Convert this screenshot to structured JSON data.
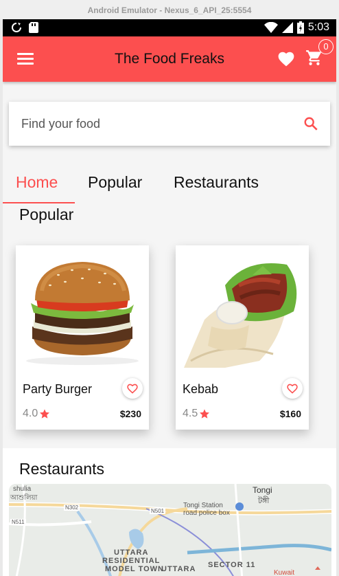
{
  "emulator": {
    "title": "Android Emulator - Nexus_6_API_25:5554"
  },
  "status_bar": {
    "time": "5:03"
  },
  "app_bar": {
    "title": "The Food Freaks",
    "cart_count": "0"
  },
  "search": {
    "placeholder": "Find your food"
  },
  "tabs": [
    {
      "label": "Home",
      "active": true
    },
    {
      "label": "Popular",
      "active": false
    },
    {
      "label": "Restaurants",
      "active": false
    }
  ],
  "popular": {
    "title": "Popular",
    "items": [
      {
        "name": "Party Burger",
        "rating": "4.0",
        "price": "$230"
      },
      {
        "name": "Kebab",
        "rating": "4.5",
        "price": "$160"
      }
    ]
  },
  "restaurants": {
    "title": "Restaurants",
    "map_labels": {
      "ashulia": "shulia",
      "ashulia_bn": "আশুলিয়া",
      "tongi": "Tongi",
      "tongi_bn": "টঙ্গী",
      "station": "Tongi Station",
      "police_box": "road police box",
      "uttara1": "UTTARA",
      "uttara2": "RESIDENTIAL",
      "uttara3": "MODEL TOWN",
      "uttara4": "UTTARA",
      "sector": "SECTOR 11",
      "n302": "N302",
      "n501": "N501",
      "n511": "N511",
      "kuwait": "Kuwait Bangladesh"
    }
  },
  "colors": {
    "accent": "#fc4f4f"
  }
}
